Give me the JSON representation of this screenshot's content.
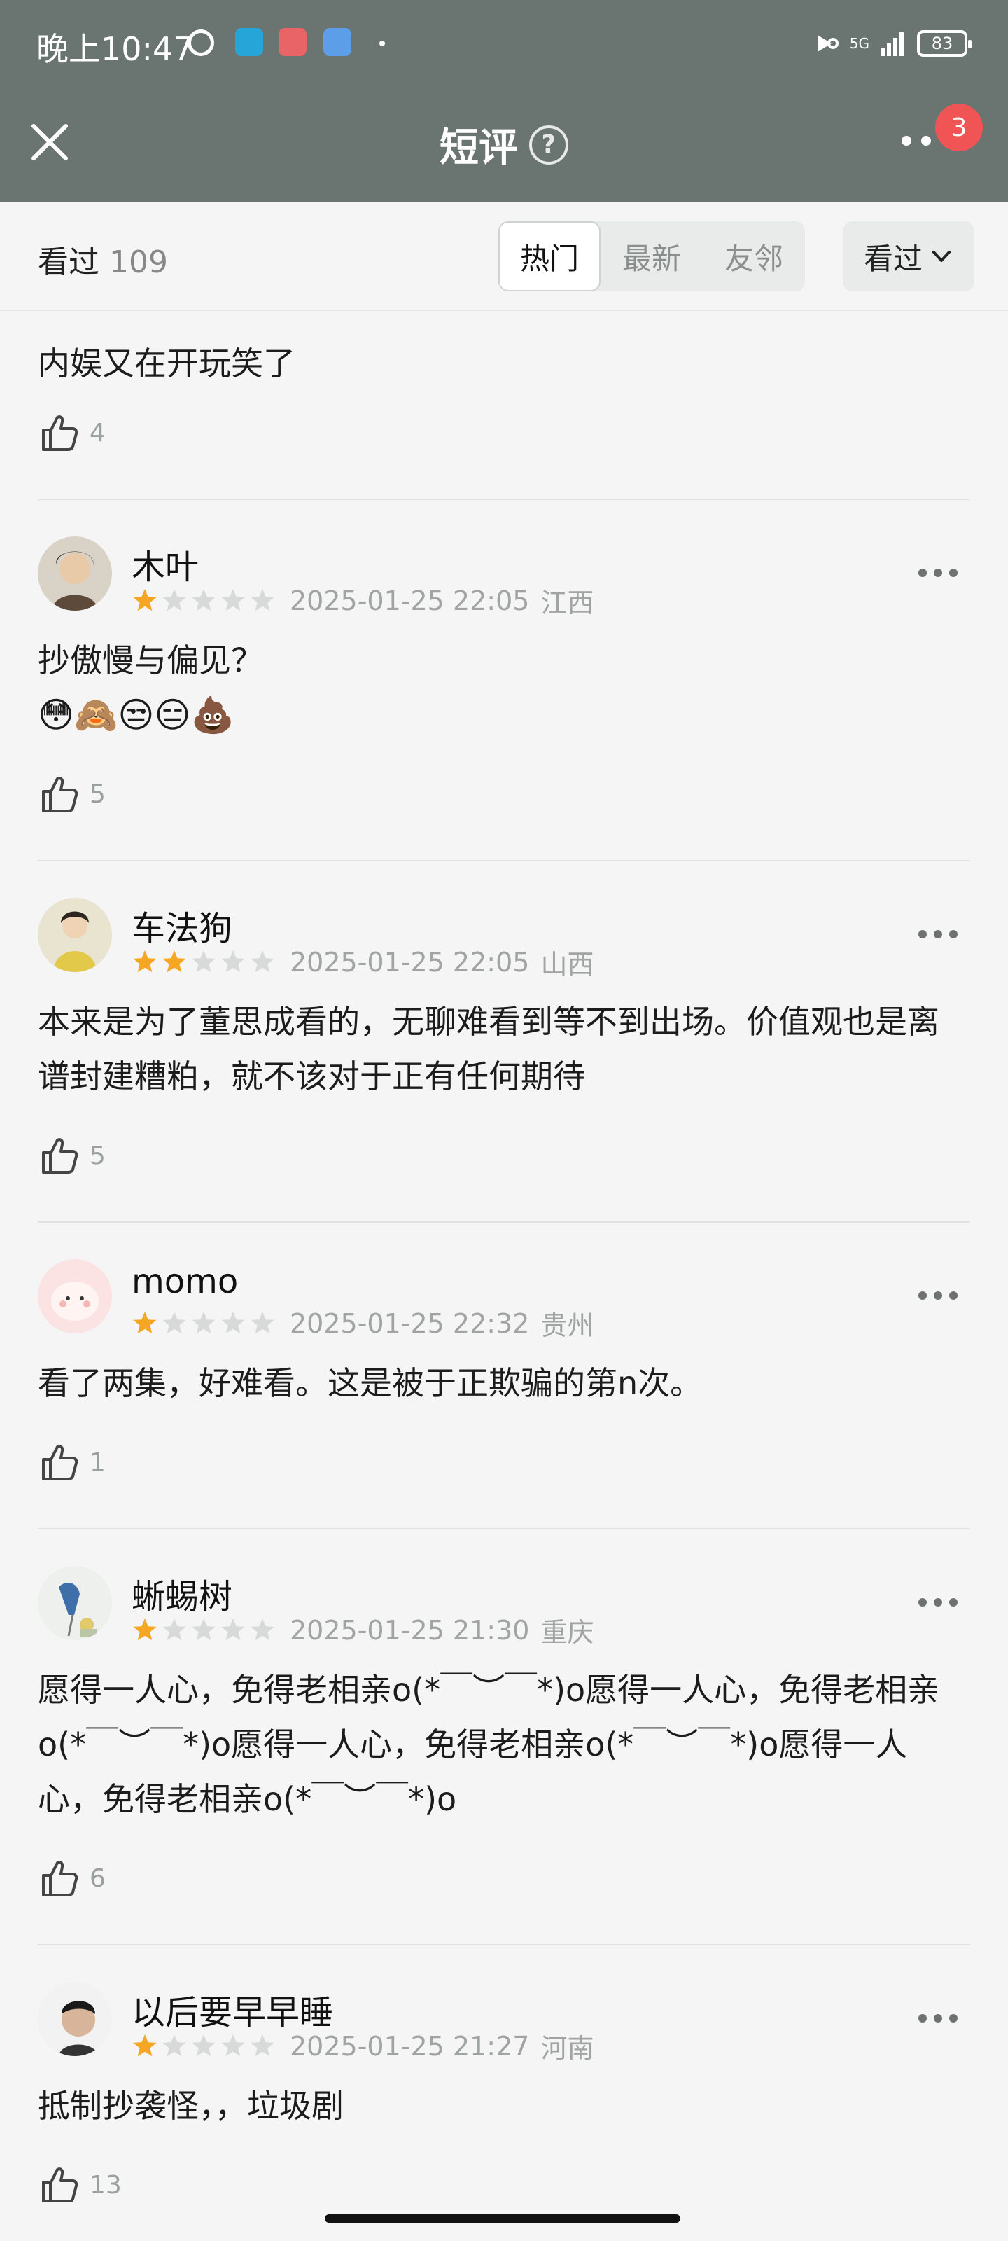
{
  "status_bar": {
    "time": "晚上10:47",
    "network": "5G",
    "battery": "83",
    "icons": [
      "clock-icon",
      "app-icon-1",
      "app-icon-2",
      "app-icon-3",
      "dot-icon",
      "nfc-icon",
      "signal-icon",
      "battery-icon"
    ]
  },
  "nav": {
    "title": "短评",
    "help_icon": "?",
    "badge": "3"
  },
  "filter": {
    "seen_label": "看过",
    "seen_count": "109",
    "tabs": [
      "热门",
      "最新",
      "友邻"
    ],
    "active_tab": "热门",
    "dropdown_label": "看过"
  },
  "colors": {
    "header_bg": "#6a7470",
    "star_on": "#f5a623",
    "star_off": "#d7dad9",
    "badge": "#f05454"
  },
  "reviews": [
    {
      "content": "内娱又在开玩笑了",
      "likes": "4"
    },
    {
      "name": "木叶",
      "rating": 1,
      "date": "2025-01-25 22:05",
      "region": "江西",
      "content": "抄傲慢与偏见？",
      "emojis": "😳🙈😒😑💩",
      "likes": "5"
    },
    {
      "name": "车法狗",
      "rating": 2,
      "date": "2025-01-25 22:05",
      "region": "山西",
      "content": "本来是为了董思成看的，无聊难看到等不到出场。价值观也是离谱封建糟粕，就不该对于正有任何期待",
      "likes": "5"
    },
    {
      "name": "momo",
      "rating": 1,
      "date": "2025-01-25 22:32",
      "region": "贵州",
      "content": "看了两集，好难看。这是被于正欺骗的第n次。",
      "likes": "1"
    },
    {
      "name": "蜥蜴树",
      "rating": 1,
      "date": "2025-01-25 21:30",
      "region": "重庆",
      "content": "愿得一人心，免得老相亲o(*￣︶￣*)o愿得一人心，免得老相亲o(*￣︶￣*)o愿得一人心，免得老相亲o(*￣︶￣*)o愿得一人心，免得老相亲o(*￣︶￣*)o",
      "likes": "6"
    },
    {
      "name": "以后要早早睡",
      "rating": 1,
      "date": "2025-01-25 21:27",
      "region": "河南",
      "content": "抵制抄袭怪，，垃圾剧",
      "likes": "13"
    }
  ]
}
